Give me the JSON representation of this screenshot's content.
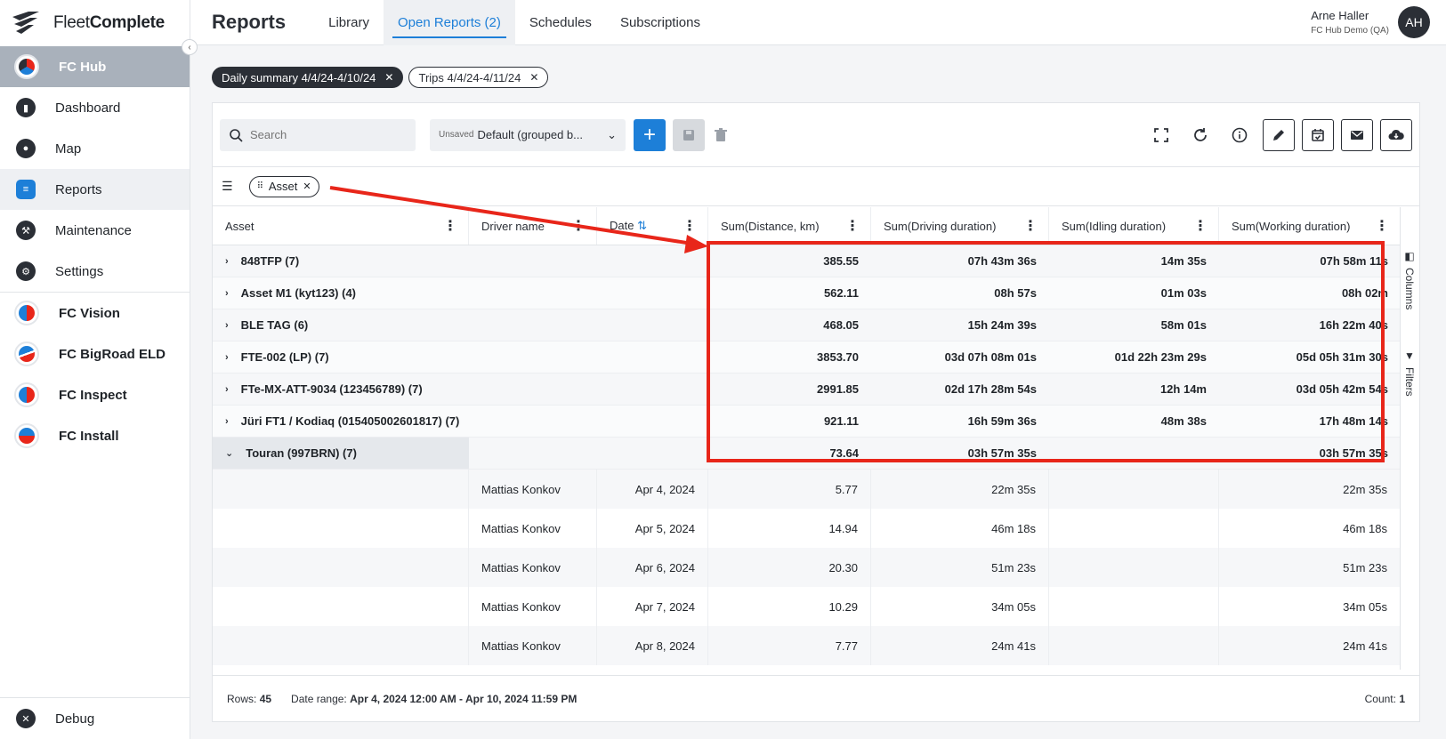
{
  "logo": {
    "text_a": "Fleet",
    "text_b": "Complete"
  },
  "sidebar": {
    "hub": "FC Hub",
    "items": [
      {
        "label": "Dashboard"
      },
      {
        "label": "Map"
      },
      {
        "label": "Reports"
      },
      {
        "label": "Maintenance"
      },
      {
        "label": "Settings"
      }
    ],
    "apps": [
      {
        "label": "FC Vision"
      },
      {
        "label": "FC BigRoad ELD"
      },
      {
        "label": "FC Inspect"
      },
      {
        "label": "FC Install"
      }
    ],
    "debug": "Debug"
  },
  "header": {
    "title": "Reports",
    "tabs": [
      "Library",
      "Open Reports (2)",
      "Schedules",
      "Subscriptions"
    ],
    "user_name": "Arne Haller",
    "user_org": "FC Hub Demo (QA)",
    "avatar": "AH"
  },
  "report_chips": [
    "Daily summary 4/4/24-4/10/24",
    "Trips 4/4/24-4/11/24"
  ],
  "toolbar": {
    "search_placeholder": "Search",
    "view_unsaved": "Unsaved",
    "view_name": "Default (grouped b...",
    "add": "+"
  },
  "grouping": {
    "chip": "Asset"
  },
  "columns": [
    "Asset",
    "Driver name",
    "Date",
    "Sum(Distance, km)",
    "Sum(Driving duration)",
    "Sum(Idling duration)",
    "Sum(Working duration)"
  ],
  "groups": [
    {
      "asset": "848TFP (7)",
      "distance": "385.55",
      "driving": "07h 43m 36s",
      "idling": "14m 35s",
      "working": "07h 58m 11s"
    },
    {
      "asset": "Asset M1 (kyt123) (4)",
      "distance": "562.11",
      "driving": "08h 57s",
      "idling": "01m 03s",
      "working": "08h 02m"
    },
    {
      "asset": "BLE TAG (6)",
      "distance": "468.05",
      "driving": "15h 24m 39s",
      "idling": "58m 01s",
      "working": "16h 22m 40s"
    },
    {
      "asset": "FTE-002 (LP) (7)",
      "distance": "3853.70",
      "driving": "03d 07h 08m 01s",
      "idling": "01d 22h 23m 29s",
      "working": "05d 05h 31m 30s"
    },
    {
      "asset": "FTe-MX-ATT-9034 (123456789) (7)",
      "distance": "2991.85",
      "driving": "02d 17h 28m 54s",
      "idling": "12h 14m",
      "working": "03d 05h 42m 54s"
    },
    {
      "asset": "Jüri FT1 / Kodiaq (015405002601817) (7)",
      "distance": "921.11",
      "driving": "16h 59m 36s",
      "idling": "48m 38s",
      "working": "17h 48m 14s"
    },
    {
      "asset": "Touran (997BRN) (7)",
      "distance": "73.64",
      "driving": "03h 57m 35s",
      "idling": "",
      "working": "03h 57m 35s"
    }
  ],
  "details": [
    {
      "driver": "Mattias Konkov",
      "date": "Apr 4, 2024",
      "distance": "5.77",
      "driving": "22m 35s",
      "idling": "",
      "working": "22m 35s"
    },
    {
      "driver": "Mattias Konkov",
      "date": "Apr 5, 2024",
      "distance": "14.94",
      "driving": "46m 18s",
      "idling": "",
      "working": "46m 18s"
    },
    {
      "driver": "Mattias Konkov",
      "date": "Apr 6, 2024",
      "distance": "20.30",
      "driving": "51m 23s",
      "idling": "",
      "working": "51m 23s"
    },
    {
      "driver": "Mattias Konkov",
      "date": "Apr 7, 2024",
      "distance": "10.29",
      "driving": "34m 05s",
      "idling": "",
      "working": "34m 05s"
    },
    {
      "driver": "Mattias Konkov",
      "date": "Apr 8, 2024",
      "distance": "7.77",
      "driving": "24m 41s",
      "idling": "",
      "working": "24m 41s"
    }
  ],
  "side_tabs": {
    "columns": "Columns",
    "filters": "Filters"
  },
  "footer": {
    "rows_label": "Rows:",
    "rows_value": "45",
    "range_label": "Date range:",
    "range_value": "Apr 4, 2024 12:00 AM - Apr 10, 2024 11:59 PM",
    "count_label": "Count:",
    "count_value": "1"
  },
  "colors": {
    "accent": "#1d7fd8",
    "annotation": "#e8261a",
    "dark": "#2b2f36"
  }
}
